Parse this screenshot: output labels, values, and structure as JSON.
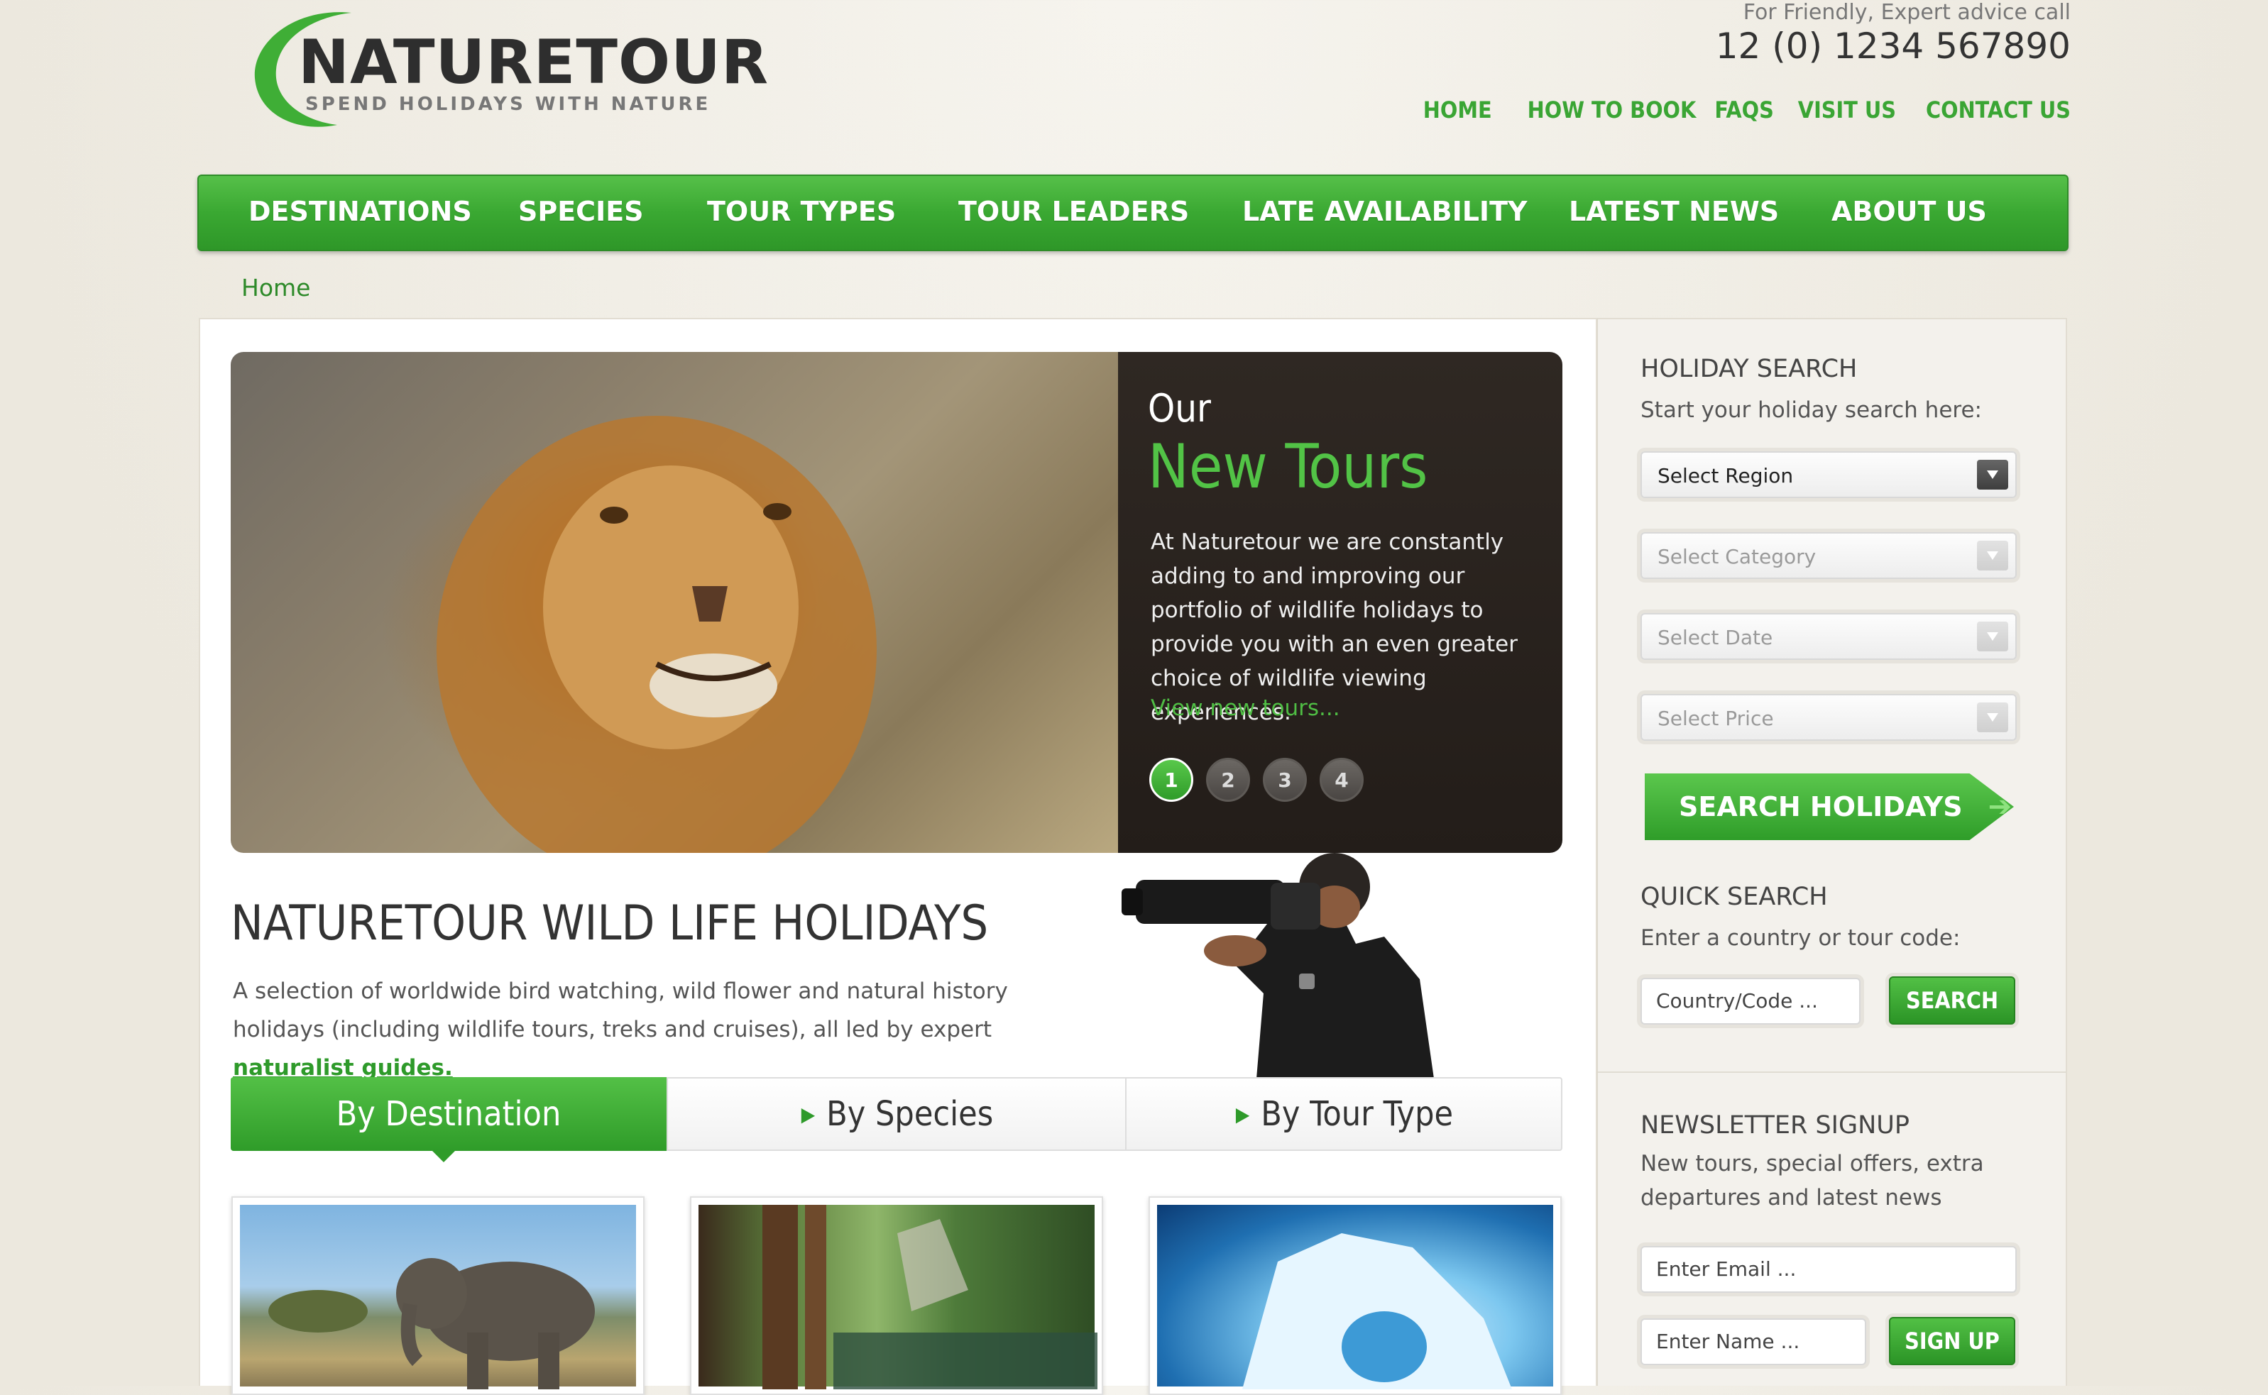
{
  "header": {
    "logo_text": "NATURETOUR",
    "logo_tagline": "SPEND HOLIDAYS WITH NATURE",
    "advice_label": "For Friendly, Expert advice call",
    "advice_phone": "12 (0) 1234 567890",
    "top_nav": [
      "HOME",
      "HOW TO BOOK",
      "FAQS",
      "VISIT US",
      "CONTACT US"
    ]
  },
  "main_nav": [
    "DESTINATIONS",
    "SPECIES",
    "TOUR TYPES",
    "TOUR LEADERS",
    "LATE AVAILABILITY",
    "LATEST NEWS",
    "ABOUT US"
  ],
  "breadcrumb": "Home",
  "slider": {
    "caption_small": "Our",
    "caption_title": "New Tours",
    "caption_body": "At Naturetour we are constantly adding to and improving our portfolio of wildlife holidays to provide you with an even greater choice of wildlife viewing experiences.",
    "caption_link": "View new tours...",
    "dots": [
      "1",
      "2",
      "3",
      "4"
    ],
    "active_dot": "1"
  },
  "intro": {
    "title": "NATURETOUR  WILD LIFE HOLIDAYS",
    "text": "A selection of worldwide bird watching, wild flower and natural history holidays (including wildlife tours, treks and cruises), all led by expert",
    "link": "naturalist guides."
  },
  "tabs": {
    "destination": "By Destination",
    "species": "By Species",
    "tour_type": "By Tour Type"
  },
  "sidebar": {
    "holiday_search": {
      "heading": "HOLIDAY SEARCH",
      "sub": "Start your holiday search here:",
      "region": "Select Region",
      "category": "Select Category",
      "date": "Select Date",
      "price": "Select Price",
      "button": "SEARCH HOLIDAYS"
    },
    "quick_search": {
      "heading": "QUICK SEARCH",
      "sub": "Enter a country or tour code:",
      "placeholder": "Country/Code ...",
      "button": "SEARCH"
    },
    "newsletter": {
      "heading": "NEWSLETTER SIGNUP",
      "sub": "New tours, special offers, extra departures and latest news",
      "email_placeholder": "Enter Email ...",
      "name_placeholder": "Enter Name ...",
      "button": "SIGN UP"
    }
  },
  "colors": {
    "brand_green": "#3aa832",
    "link_green": "#2e9a2a",
    "caption_bg": "#2a231f"
  }
}
